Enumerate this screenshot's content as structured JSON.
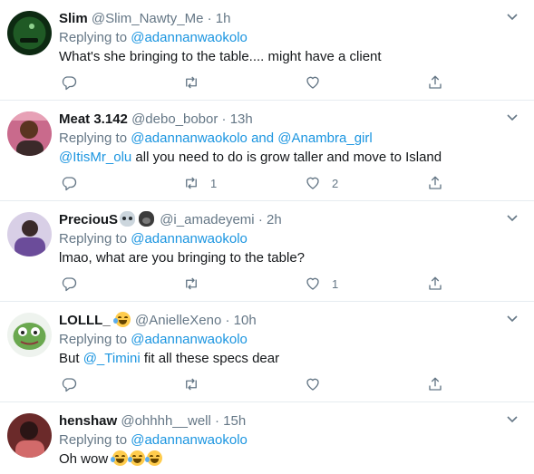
{
  "tweets": [
    {
      "name": "Slim",
      "handle": "@Slim_Nawty_Me",
      "time": "1h",
      "replying_prefix": "Replying to",
      "replying_to": "@adannanwaokolo",
      "text": "What's she bringing to the table.... might have a client",
      "reply_count": "",
      "retweet_count": "",
      "like_count": ""
    },
    {
      "name": "Meat 3.142",
      "handle": "@debo_bobor",
      "time": "13h",
      "replying_prefix": "Replying to",
      "replying_to": "@adannanwaokolo",
      "replying_and": "and",
      "replying_to_2": "@Anambra_girl",
      "mention": "@ItisMr_olu",
      "text": " all you need to do is grow taller and move to Island",
      "reply_count": "",
      "retweet_count": "1",
      "like_count": "2"
    },
    {
      "name": "PreciouS",
      "handle": "@i_amadeyemi",
      "time": "2h",
      "replying_prefix": "Replying to",
      "replying_to": "@adannanwaokolo",
      "text": "lmao, what are you bringing to the table?",
      "reply_count": "",
      "retweet_count": "",
      "like_count": "1"
    },
    {
      "name": "LOLLL_",
      "handle": "@AnielleXeno",
      "time": "10h",
      "replying_prefix": "Replying to",
      "replying_to": "@adannanwaokolo",
      "text_prefix": "But ",
      "mention": "@_Timini",
      "text": " fit all these specs dear",
      "reply_count": "",
      "retweet_count": "",
      "like_count": ""
    },
    {
      "name": "henshaw",
      "handle": "@ohhhh__well",
      "time": "15h",
      "replying_prefix": "Replying to",
      "replying_to": "@adannanwaokolo",
      "text": "Oh wow "
    }
  ],
  "separator": "·",
  "icons": [
    "reply-icon",
    "retweet-icon",
    "like-icon",
    "share-icon",
    "caret-down-icon",
    "face-with-tears-of-joy-emoji",
    "skull-emoji",
    "gorilla-emoji"
  ],
  "colors": {
    "link": "#1b95e0",
    "muted": "#657786",
    "text": "#14171a",
    "divider": "#e6ecf0"
  }
}
